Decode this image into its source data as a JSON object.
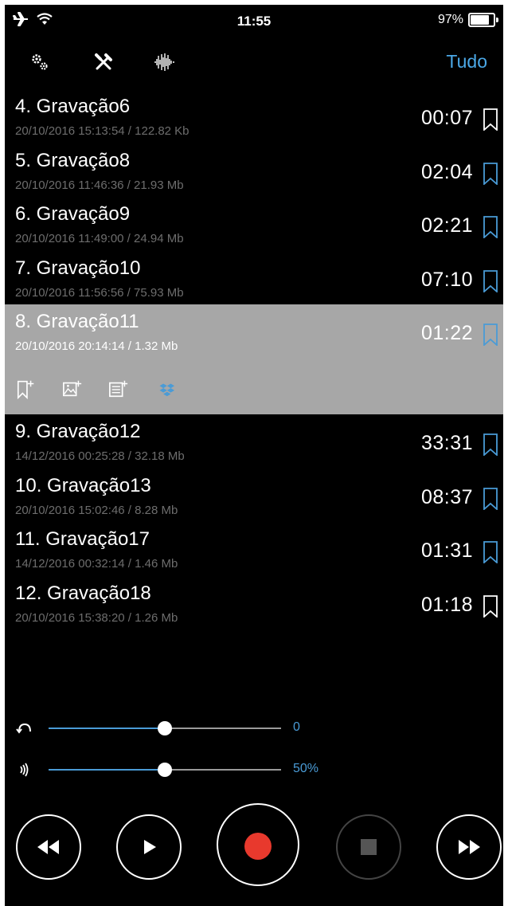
{
  "status_bar": {
    "time": "11:55",
    "battery": "97%",
    "battery_level": 0.97
  },
  "toolbar": {
    "icons": [
      "settings-icon",
      "tools-icon",
      "waveform-icon"
    ],
    "filter_label": "Tudo"
  },
  "recordings": [
    {
      "title": "4. Gravação6",
      "meta": "20/10/2016 15:13:54 / 122.82 Kb",
      "duration": "00:07",
      "bookmark_color": "#ffffff"
    },
    {
      "title": "5. Gravação8",
      "meta": "20/10/2016 11:46:36 / 21.93 Mb",
      "duration": "02:04",
      "bookmark_color": "#4a9bd6"
    },
    {
      "title": "6. Gravação9",
      "meta": "20/10/2016 11:49:00 / 24.94 Mb",
      "duration": "02:21",
      "bookmark_color": "#4a9bd6"
    },
    {
      "title": "7. Gravação10",
      "meta": "20/10/2016 11:56:56 / 75.93 Mb",
      "duration": "07:10",
      "bookmark_color": "#4a9bd6"
    },
    {
      "title": "8. Gravação11",
      "meta": "20/10/2016 20:14:14 / 1.32 Mb",
      "duration": "01:22",
      "bookmark_color": "#4a9bd6",
      "selected": true
    },
    {
      "title": "9. Gravação12",
      "meta": "14/12/2016 00:25:28 / 32.18 Mb",
      "duration": "33:31",
      "bookmark_color": "#4a9bd6"
    },
    {
      "title": "10. Gravação13",
      "meta": "20/10/2016 15:02:46 / 8.28 Mb",
      "duration": "08:37",
      "bookmark_color": "#4a9bd6"
    },
    {
      "title": "11. Gravação17",
      "meta": "14/12/2016 00:32:14 / 1.46 Mb",
      "duration": "01:31",
      "bookmark_color": "#4a9bd6"
    },
    {
      "title": "12. Gravação18",
      "meta": "20/10/2016 15:38:20 / 1.26 Mb",
      "duration": "01:18",
      "bookmark_color": "#ffffff"
    }
  ],
  "selected_actions": [
    "add-bookmark-icon",
    "add-image-icon",
    "add-note-icon",
    "dropbox-icon"
  ],
  "sliders": {
    "repeat": {
      "value_label": "0",
      "position": 0.5
    },
    "volume": {
      "value_label": "50%",
      "position": 0.5
    }
  },
  "transport": [
    "rewind-button",
    "play-button",
    "record-button",
    "stop-button",
    "fast-forward-button"
  ],
  "colors": {
    "accent": "#4a9bd6",
    "record": "#e8392d",
    "selected_row": "#a7a7a7"
  }
}
